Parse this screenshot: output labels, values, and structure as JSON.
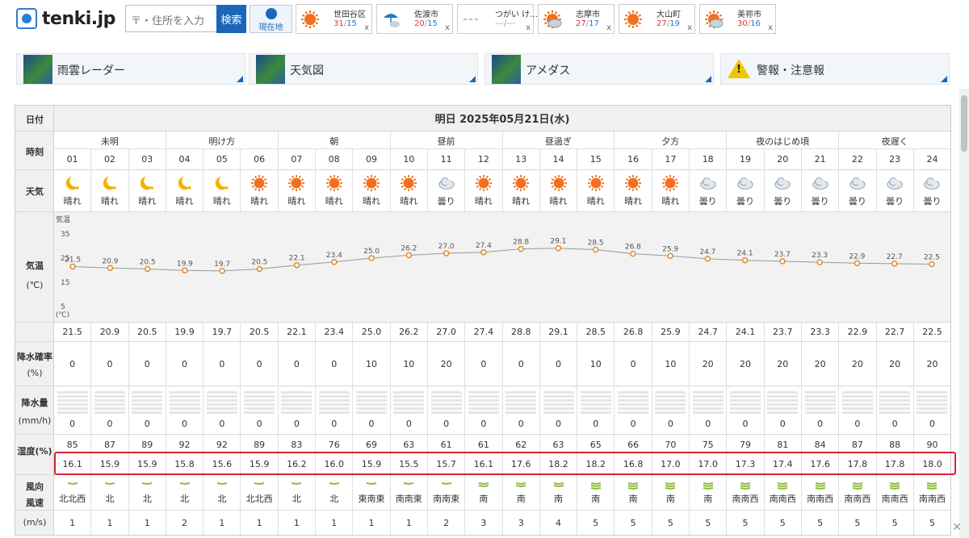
{
  "header": {
    "logo_text": "tenki.jp",
    "search_placeholder": "〒・住所を入力",
    "search_button": "検索",
    "geo_button": "現在地",
    "cities": [
      {
        "name": "世田谷区",
        "hi": "31",
        "lo": "15",
        "icon": "sun-icon"
      },
      {
        "name": "佐渡市",
        "hi": "20",
        "lo": "15",
        "icon": "rain-icon"
      },
      {
        "name": "つがい け…",
        "hi": "---",
        "lo": "---",
        "icon": "none"
      },
      {
        "name": "志摩市",
        "hi": "27",
        "lo": "17",
        "icon": "sun-cloud-icon"
      },
      {
        "name": "大山町",
        "hi": "27",
        "lo": "19",
        "icon": "sun-icon"
      },
      {
        "name": "美祢市",
        "hi": "30",
        "lo": "16",
        "icon": "sun-cloud-icon"
      }
    ],
    "close_label": "x"
  },
  "nav": [
    "雨雲レーダー",
    "天気図",
    "アメダス",
    "警報・注意報"
  ],
  "table": {
    "date_label": "日付",
    "date_title": "明日 2025年05月21日(水)",
    "time_label": "時刻",
    "periods": [
      "未明",
      "明け方",
      "朝",
      "昼前",
      "昼過ぎ",
      "夕方",
      "夜のはじめ頃",
      "夜遅く"
    ],
    "hours": [
      "01",
      "02",
      "03",
      "04",
      "05",
      "06",
      "07",
      "08",
      "09",
      "10",
      "11",
      "12",
      "13",
      "14",
      "15",
      "16",
      "17",
      "18",
      "19",
      "20",
      "21",
      "22",
      "23",
      "24"
    ],
    "weather_label": "天気",
    "weather": [
      "晴れ",
      "晴れ",
      "晴れ",
      "晴れ",
      "晴れ",
      "晴れ",
      "晴れ",
      "晴れ",
      "晴れ",
      "晴れ",
      "曇り",
      "晴れ",
      "晴れ",
      "晴れ",
      "晴れ",
      "晴れ",
      "晴れ",
      "曇り",
      "曇り",
      "曇り",
      "曇り",
      "曇り",
      "曇り",
      "曇り"
    ],
    "weather_icons": [
      "moon-icon",
      "moon-icon",
      "moon-icon",
      "moon-icon",
      "moon-icon",
      "sun-icon",
      "sun-icon",
      "sun-icon",
      "sun-icon",
      "sun-icon",
      "cloud-icon",
      "sun-icon",
      "sun-icon",
      "sun-icon",
      "sun-icon",
      "sun-icon",
      "sun-icon",
      "cloud-icon",
      "cloud-icon",
      "cloud-icon",
      "cloud-icon",
      "cloud-icon",
      "cloud-icon",
      "cloud-icon"
    ],
    "temp_label": "気温",
    "temp_unit": "(℃)",
    "chart_axis_title": "気温",
    "chart_axis_unit": "(℃)",
    "chart_ticks": [
      "35",
      "25",
      "15",
      "5"
    ],
    "temps": [
      "21.5",
      "20.9",
      "20.5",
      "19.9",
      "19.7",
      "20.5",
      "22.1",
      "23.4",
      "25.0",
      "26.2",
      "27.0",
      "27.4",
      "28.8",
      "29.1",
      "28.5",
      "26.8",
      "25.9",
      "24.7",
      "24.1",
      "23.7",
      "23.3",
      "22.9",
      "22.7",
      "22.5"
    ],
    "precip_prob_label": "降水確率",
    "precip_prob_unit": "(%)",
    "precip_prob": [
      "0",
      "0",
      "0",
      "0",
      "0",
      "0",
      "0",
      "0",
      "10",
      "10",
      "20",
      "0",
      "0",
      "0",
      "10",
      "0",
      "10",
      "20",
      "20",
      "20",
      "20",
      "20",
      "20",
      "20"
    ],
    "precip_label": "降水量",
    "precip_unit": "(mm/h)",
    "precip": [
      "0",
      "0",
      "0",
      "0",
      "0",
      "0",
      "0",
      "0",
      "0",
      "0",
      "0",
      "0",
      "0",
      "0",
      "0",
      "0",
      "0",
      "0",
      "0",
      "0",
      "0",
      "0",
      "0",
      "0"
    ],
    "humidity_label": "湿度(%)",
    "humidity": [
      "85",
      "87",
      "89",
      "92",
      "92",
      "89",
      "83",
      "76",
      "69",
      "63",
      "61",
      "61",
      "62",
      "63",
      "65",
      "66",
      "70",
      "75",
      "79",
      "81",
      "84",
      "87",
      "88",
      "90"
    ],
    "dewpoint": [
      "16.1",
      "15.9",
      "15.9",
      "15.8",
      "15.6",
      "15.9",
      "16.2",
      "16.0",
      "15.9",
      "15.5",
      "15.7",
      "16.1",
      "17.6",
      "18.2",
      "18.2",
      "16.8",
      "17.0",
      "17.0",
      "17.3",
      "17.4",
      "17.6",
      "17.8",
      "17.8",
      "18.0"
    ],
    "wind_label_dir": "風向",
    "wind_label_speed": "風速",
    "wind_unit": "(m/s)",
    "wind_dir": [
      "北北西",
      "北",
      "北",
      "北",
      "北",
      "北北西",
      "北",
      "北",
      "東南東",
      "南南東",
      "南南東",
      "南",
      "南",
      "南",
      "南",
      "南",
      "南",
      "南",
      "南南西",
      "南南西",
      "南南西",
      "南南西",
      "南南西",
      "南南西"
    ],
    "wind_speed": [
      "1",
      "1",
      "1",
      "2",
      "1",
      "1",
      "1",
      "1",
      "1",
      "1",
      "2",
      "3",
      "3",
      "4",
      "5",
      "5",
      "5",
      "5",
      "5",
      "5",
      "5",
      "5",
      "5",
      "5"
    ]
  },
  "chart_data": {
    "type": "line",
    "x": [
      "01",
      "02",
      "03",
      "04",
      "05",
      "06",
      "07",
      "08",
      "09",
      "10",
      "11",
      "12",
      "13",
      "14",
      "15",
      "16",
      "17",
      "18",
      "19",
      "20",
      "21",
      "22",
      "23",
      "24"
    ],
    "series": [
      {
        "values": [
          21.5,
          20.9,
          20.5,
          19.9,
          19.7,
          20.5,
          22.1,
          23.4,
          25.0,
          26.2,
          27.0,
          27.4,
          28.8,
          29.1,
          28.5,
          26.8,
          25.9,
          24.7,
          24.1,
          23.7,
          23.3,
          22.9,
          22.7,
          22.5
        ]
      }
    ],
    "ylim": [
      0,
      42
    ],
    "yticks": [
      35,
      25,
      15,
      5
    ],
    "ylabel": "気温",
    "grid": false,
    "color": "#e08a2a"
  },
  "colors": {
    "accent": "#1a67b8",
    "highlight": "#d9252f",
    "sun": "#f0701f",
    "moon": "#f2b400"
  }
}
